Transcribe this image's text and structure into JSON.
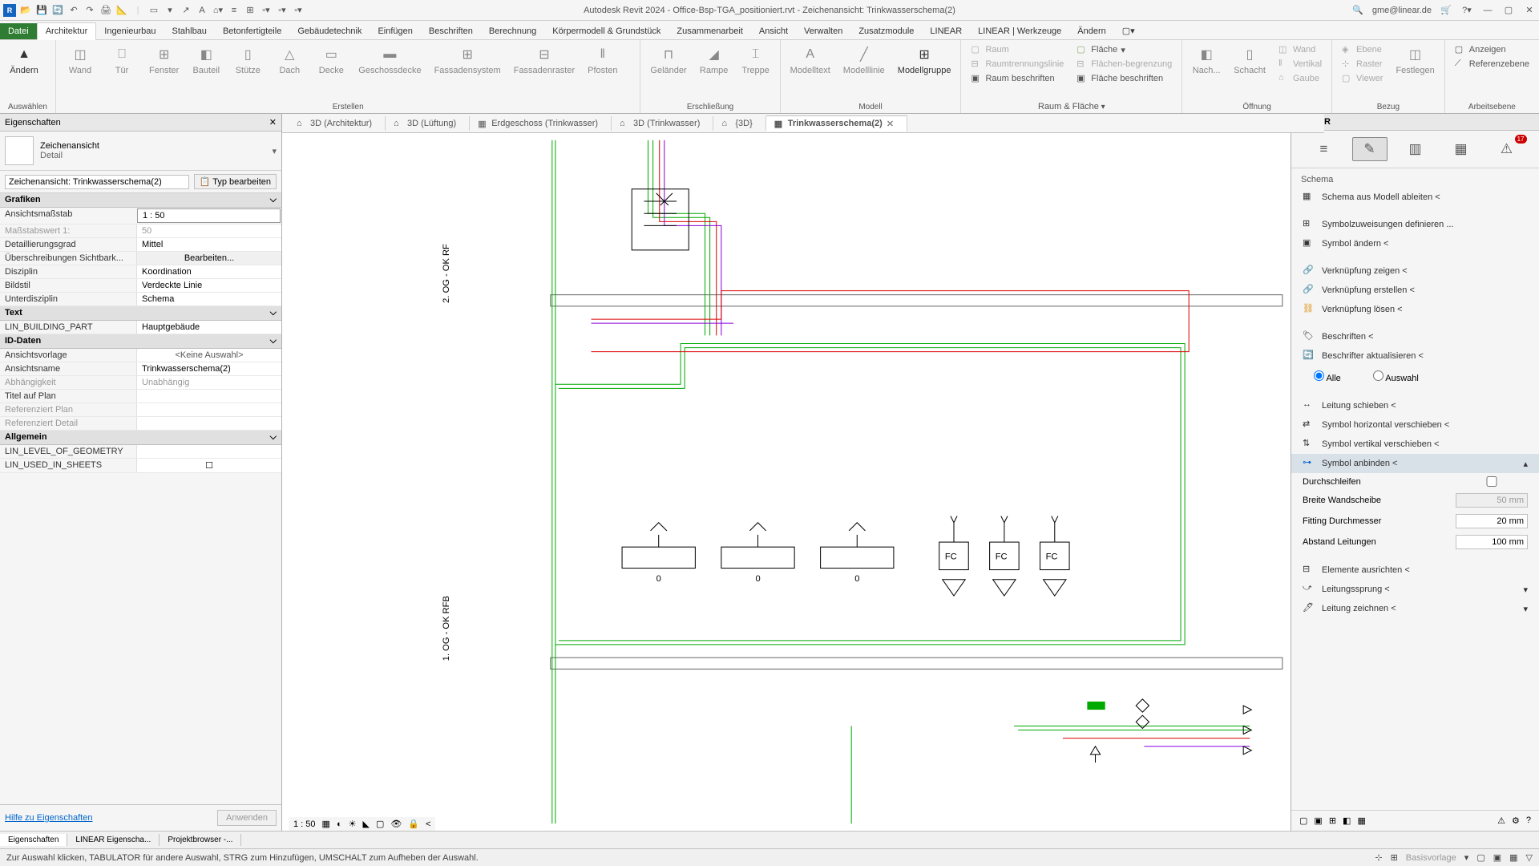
{
  "app": {
    "title": "Autodesk Revit 2024 - Office-Bsp-TGA_positioniert.rvt - Zeichenansicht: Trinkwasserschema(2)",
    "user": "gme@linear.de"
  },
  "ribbon_tabs": {
    "datei": "Datei",
    "architektur": "Architektur",
    "ingenieurbau": "Ingenieurbau",
    "stahlbau": "Stahlbau",
    "betonfertigteile": "Betonfertigteile",
    "gebaeudetechnik": "Gebäudetechnik",
    "einfuegen": "Einfügen",
    "beschriften": "Beschriften",
    "berechnung": "Berechnung",
    "koerpermodell": "Körpermodell & Grundstück",
    "zusammenarbeit": "Zusammenarbeit",
    "ansicht": "Ansicht",
    "verwalten": "Verwalten",
    "zusatzmodule": "Zusatzmodule",
    "linear": "LINEAR",
    "linear_werkzeuge": "LINEAR | Werkzeuge",
    "aendern": "Ändern"
  },
  "ribbon": {
    "auswaehlen": "Auswählen",
    "aendern": "Ändern",
    "wand": "Wand",
    "tuer": "Tür",
    "fenster": "Fenster",
    "bauteil": "Bauteil",
    "stuetze": "Stütze",
    "dach": "Dach",
    "decke": "Decke",
    "geschossdecke": "Geschossdecke",
    "fassadensystem": "Fassadensystem",
    "fassadenraster": "Fassadenraster",
    "pfosten": "Pfosten",
    "erstellen": "Erstellen",
    "gelaender": "Geländer",
    "rampe": "Rampe",
    "treppe": "Treppe",
    "erschliessung": "Erschließung",
    "modelltext": "Modelltext",
    "modelllinie": "Modelllinie",
    "modellgruppe": "Modellgruppe",
    "modell": "Modell",
    "raum": "Raum",
    "raumtrennungslinie": "Raumtrennungslinie",
    "raum_beschriften": "Raum  beschriften",
    "flaeche": "Fläche",
    "flaechenbegrenzung": "Flächen-begrenzung",
    "flaeche_beschriften": "Fläche  beschriften",
    "raum_flaeche": "Raum & Fläche",
    "nach_flaeche": "Nach...",
    "schacht": "Schacht",
    "wand_s": "Wand",
    "vertikal": "Vertikal",
    "gaube": "Gaube",
    "oeffnung": "Öffnung",
    "ebene": "Ebene",
    "raster": "Raster",
    "viewer": "Viewer",
    "festlegen": "Festlegen",
    "bezug": "Bezug",
    "anzeigen": "Anzeigen",
    "referenzebene": "Referenzebene",
    "arbeitsebene": "Arbeitsebene"
  },
  "properties": {
    "title": "Eigenschaften",
    "family": "Zeichenansicht",
    "family_type": "Detail",
    "instance": "Zeichenansicht: Trinkwasserschema(2)",
    "edit_type": "Typ bearbeiten",
    "groups": {
      "grafiken": "Grafiken",
      "text": "Text",
      "id": "ID-Daten",
      "allgemein": "Allgemein"
    },
    "rows": {
      "ansichtsmassstab": {
        "label": "Ansichtsmaßstab",
        "value": "1 : 50"
      },
      "massstabswert": {
        "label": "Maßstabswert 1:",
        "value": "50"
      },
      "detaillierungsgrad": {
        "label": "Detaillierungsgrad",
        "value": "Mittel"
      },
      "ueberschreibungen": {
        "label": "Überschreibungen Sichtbark...",
        "value": "Bearbeiten..."
      },
      "disziplin": {
        "label": "Disziplin",
        "value": "Koordination"
      },
      "bildstil": {
        "label": "Bildstil",
        "value": "Verdeckte Linie"
      },
      "unterdisziplin": {
        "label": "Unterdisziplin",
        "value": "Schema"
      },
      "lin_building": {
        "label": "LIN_BUILDING_PART",
        "value": "Hauptgebäude"
      },
      "ansichtsvorlage": {
        "label": "Ansichtsvorlage",
        "value": "<Keine Auswahl>"
      },
      "ansichtsname": {
        "label": "Ansichtsname",
        "value": "Trinkwasserschema(2)"
      },
      "abhaengigkeit": {
        "label": "Abhängigkeit",
        "value": "Unabhängig"
      },
      "titel_plan": {
        "label": "Titel auf Plan",
        "value": ""
      },
      "referenziert_plan": {
        "label": "Referenziert Plan",
        "value": ""
      },
      "referenziert_detail": {
        "label": "Referenziert Detail",
        "value": ""
      },
      "lin_level_geom": {
        "label": "LIN_LEVEL_OF_GEOMETRY",
        "value": ""
      },
      "lin_used_sheets": {
        "label": "LIN_USED_IN_SHEETS",
        "value": ""
      }
    },
    "help": "Hilfe zu Eigenschaften",
    "apply": "Anwenden"
  },
  "view_tabs": {
    "t1": "3D (Architektur)",
    "t2": "3D (Lüftung)",
    "t3": "Erdgeschoss (Trinkwasser)",
    "t4": "3D (Trinkwasser)",
    "t5": "{3D}",
    "t6": "Trinkwasserschema(2)"
  },
  "linear": {
    "title": "LINEAR",
    "section": "Schema",
    "schema_ableiten": "Schema aus Modell ableiten <",
    "symbolzuweisungen": "Symbolzuweisungen definieren ...",
    "symbol_aendern": "Symbol ändern <",
    "verkn_zeigen": "Verknüpfung zeigen <",
    "verkn_erstellen": "Verknüpfung erstellen <",
    "verkn_loesen": "Verknüpfung lösen <",
    "beschriften": "Beschriften <",
    "beschrifter_akt": "Beschrifter aktualisieren <",
    "alle": "Alle",
    "auswahl": "Auswahl",
    "leitung_schieben": "Leitung schieben <",
    "symbol_horiz": "Symbol horizontal verschieben <",
    "symbol_vert": "Symbol vertikal verschieben <",
    "symbol_anbinden": "Symbol anbinden <",
    "durchschleifen": "Durchschleifen",
    "breite_wandscheibe": "Breite Wandscheibe",
    "breite_val": "50 mm",
    "fitting_dm": "Fitting Durchmesser",
    "fitting_val": "20 mm",
    "abstand_leitungen": "Abstand Leitungen",
    "abstand_val": "100 mm",
    "elemente_ausrichten": "Elemente ausrichten <",
    "leitungssprung": "Leitungssprung <",
    "leitung_zeichnen": "Leitung zeichnen <"
  },
  "bottom_tabs": {
    "eigenschaften": "Eigenschaften",
    "linear_eig": "LINEAR Eigenscha...",
    "projektbrowser": "Projektbrowser -..."
  },
  "view_ctrl": {
    "scale": "1 : 50"
  },
  "status": {
    "msg": "Zur Auswahl klicken, TABULATOR für andere Auswahl, STRG zum Hinzufügen, UMSCHALT zum Aufheben der Auswahl.",
    "basis": "Basisvorlage"
  },
  "drawing_labels": {
    "floor1": "1. OG - OK RFB",
    "floor2": "2. OG - OK RF",
    "fc": "FC",
    "zero": "0"
  }
}
